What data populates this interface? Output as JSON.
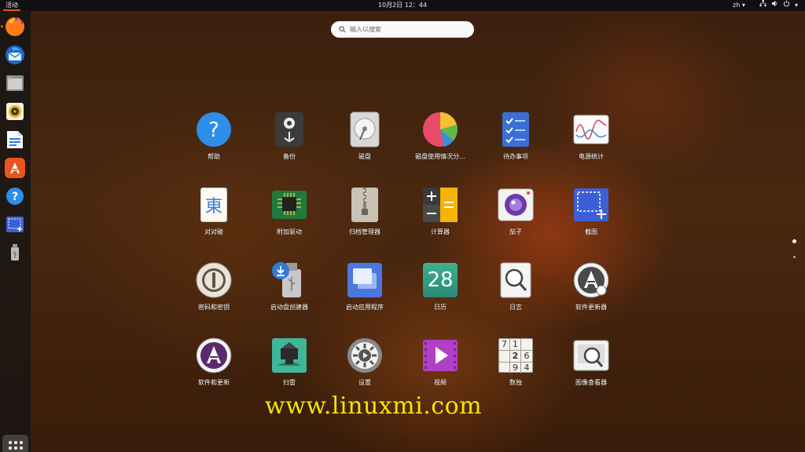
{
  "topbar": {
    "activities": "活动",
    "clock": "10月2日  12：44",
    "lang": "zh ▾",
    "tray_network_icon": "network-icon",
    "tray_volume_icon": "volume-icon",
    "tray_power_icon": "power-icon",
    "tray_menu_arrow": "▾"
  },
  "search": {
    "placeholder": "输入以搜索",
    "icon": "search-icon"
  },
  "dock": {
    "items": [
      {
        "name": "firefox",
        "icon": "firefox-icon",
        "running": true
      },
      {
        "name": "thunderbird",
        "icon": "thunderbird-icon",
        "running": false
      },
      {
        "name": "files",
        "icon": "files-icon",
        "running": false
      },
      {
        "name": "rhythmbox",
        "icon": "rhythmbox-icon",
        "running": false
      },
      {
        "name": "libreoffice-writer",
        "icon": "writer-icon",
        "running": false
      },
      {
        "name": "software",
        "icon": "software-icon",
        "running": false
      },
      {
        "name": "help",
        "icon": "help-icon",
        "running": false
      },
      {
        "name": "screenshot",
        "icon": "screenshot-icon",
        "running": false
      },
      {
        "name": "usb-drive",
        "icon": "usb-icon",
        "running": false
      }
    ],
    "show_apps_icon": "show-applications-icon"
  },
  "apps": [
    {
      "label": "帮助",
      "icon": "help-icon"
    },
    {
      "label": "备份",
      "icon": "backup-icon"
    },
    {
      "label": "磁盘",
      "icon": "disks-icon"
    },
    {
      "label": "磁盘使用情况分...",
      "icon": "disk-usage-icon"
    },
    {
      "label": "待办事项",
      "icon": "todo-icon"
    },
    {
      "label": "电源统计",
      "icon": "power-statistics-icon"
    },
    {
      "label": "对对碰",
      "icon": "mahjongg-icon",
      "glyph": "東"
    },
    {
      "label": "附加驱动",
      "icon": "additional-drivers-icon"
    },
    {
      "label": "归档管理器",
      "icon": "archive-manager-icon"
    },
    {
      "label": "计算器",
      "icon": "calculator-icon"
    },
    {
      "label": "茄子",
      "icon": "cheese-icon"
    },
    {
      "label": "截图",
      "icon": "screenshot-icon"
    },
    {
      "label": "密码和密钥",
      "icon": "passwords-keys-icon"
    },
    {
      "label": "启动盘创建器",
      "icon": "startup-disk-creator-icon"
    },
    {
      "label": "启动应用程序",
      "icon": "startup-applications-icon"
    },
    {
      "label": "日历",
      "icon": "calendar-icon",
      "glyph": "28"
    },
    {
      "label": "日志",
      "icon": "logs-icon"
    },
    {
      "label": "软件更新器",
      "icon": "software-updater-icon"
    },
    {
      "label": "软件和更新",
      "icon": "software-updates-icon"
    },
    {
      "label": "扫雷",
      "icon": "mines-icon"
    },
    {
      "label": "设置",
      "icon": "settings-icon"
    },
    {
      "label": "视频",
      "icon": "videos-icon"
    },
    {
      "label": "数独",
      "icon": "sudoku-icon",
      "glyph_cells": [
        "7",
        "1",
        "",
        "",
        "2",
        "6",
        "",
        "9",
        "4"
      ]
    },
    {
      "label": "图像查看器",
      "icon": "image-viewer-icon"
    }
  ],
  "watermark": "www.linuxmi.com",
  "colors": {
    "accent": "#e95420",
    "watermark": "#f2e600",
    "topbar": "#101010"
  }
}
